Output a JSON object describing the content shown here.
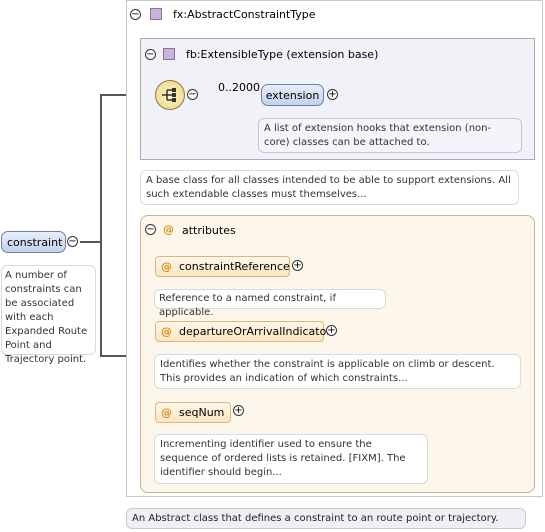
{
  "root": {
    "label": "constraint",
    "doc": "A number of constraints can be associated with each Expanded Route Point and Trajectory point."
  },
  "type": {
    "name": "fx:AbstractConstraintType",
    "doc": "An Abstract class that defines a constraint to an route point or trajectory."
  },
  "extension_base": {
    "name": "fb:ExtensibleType (extension base)",
    "doc": "A base class for all classes intended to be able to support extensions. All such extendable classes must themselves..."
  },
  "sequence": {
    "cardinality": "0..2000",
    "element": "extension",
    "element_doc": "A list of extension hooks that extension (non-core) classes can be attached to."
  },
  "attributes": {
    "label": "attributes",
    "items": [
      {
        "name": "constraintReference",
        "doc": "Reference to a named constraint, if applicable."
      },
      {
        "name": "departureOrArrivalIndicator",
        "doc": "Identifies whether the constraint is applicable on climb or descent. This provides an indication of which constraints..."
      },
      {
        "name": "seqNum",
        "doc": "Incrementing identifier used to ensure the sequence of ordered lists is retained. [FIXM]. The identifier should begin..."
      }
    ]
  },
  "symbols": {
    "at": "@",
    "collapse": "−",
    "expand": "+"
  }
}
